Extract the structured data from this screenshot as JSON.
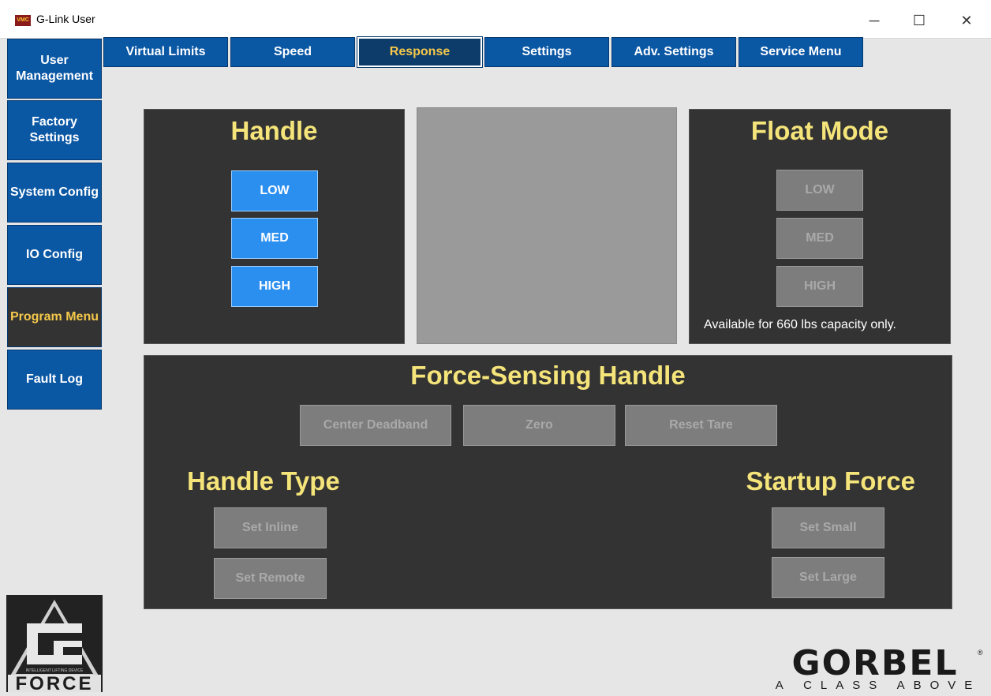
{
  "window": {
    "app_icon_text": "VMC",
    "title": "G-Link User",
    "minimize": "─",
    "maximize": "☐",
    "close": "✕"
  },
  "sidebar": {
    "items": [
      {
        "label": "User Management"
      },
      {
        "label": "Factory Settings"
      },
      {
        "label": "System Config"
      },
      {
        "label": "IO Config"
      },
      {
        "label": "Program Menu"
      },
      {
        "label": "Fault Log"
      }
    ],
    "active_index": 4
  },
  "tabs": {
    "items": [
      {
        "label": "Virtual Limits"
      },
      {
        "label": "Speed"
      },
      {
        "label": "Response"
      },
      {
        "label": "Settings"
      },
      {
        "label": "Adv. Settings"
      },
      {
        "label": "Service Menu"
      }
    ],
    "active_index": 2
  },
  "handle_panel": {
    "title": "Handle",
    "buttons": [
      "LOW",
      "MED",
      "HIGH"
    ]
  },
  "float_mode_panel": {
    "title": "Float Mode",
    "buttons": [
      "LOW",
      "MED",
      "HIGH"
    ],
    "note": "Available for 660 lbs capacity only."
  },
  "force_sensing_panel": {
    "title": "Force-Sensing Handle",
    "buttons": [
      "Center Deadband",
      "Zero",
      "Reset Tare"
    ],
    "handle_type": {
      "title": "Handle Type",
      "buttons": [
        "Set Inline",
        "Set Remote"
      ]
    },
    "startup_force": {
      "title": "Startup Force",
      "buttons": [
        "Set Small",
        "Set Large"
      ]
    }
  },
  "logos": {
    "gforce_word": "FORCE",
    "gforce_tagline": "INTELLIGENT LIFTING DEVICE",
    "gorbel_word": "GORBEL",
    "gorbel_tagline": "A CLASS ABOVE"
  },
  "colors": {
    "accent_blue": "#0a57a4",
    "button_blue": "#2b8ff0",
    "panel_dark": "#333333",
    "title_yellow": "#f5e47a",
    "active_text": "#f5c84a"
  }
}
